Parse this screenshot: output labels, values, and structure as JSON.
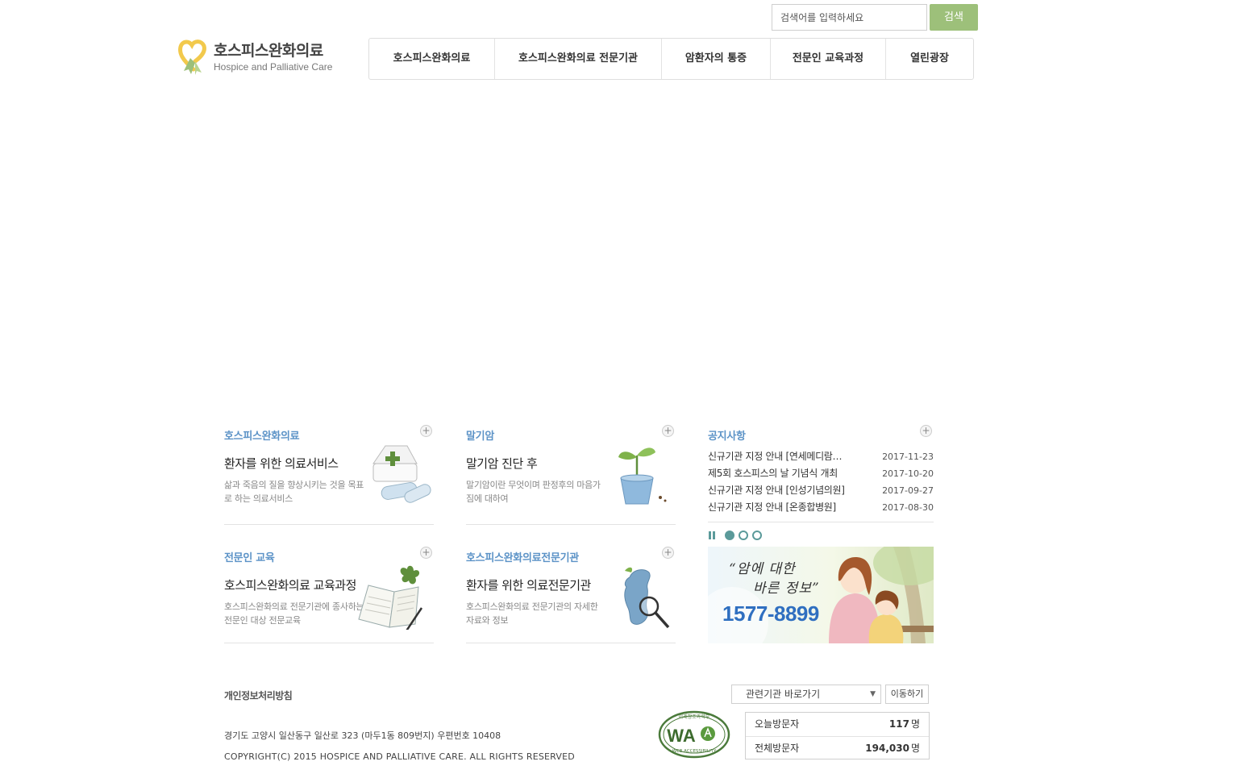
{
  "search": {
    "placeholder": "검색어를 입력하세요",
    "button_label": "검색"
  },
  "logo": {
    "title": "호스피스완화의료",
    "subtitle": "Hospice and Palliative Care"
  },
  "nav": {
    "items": [
      {
        "label": "호스피스완화의료"
      },
      {
        "label": "호스피스완화의료 전문기관"
      },
      {
        "label": "암환자의 통증"
      },
      {
        "label": "전문인 교육과정"
      },
      {
        "label": "열린광장"
      }
    ]
  },
  "boxes": {
    "hospice": {
      "title": "호스피스완화의료",
      "heading": "환자를 위한 의료서비스",
      "desc": "삶과 죽음의 질을 향상시키는 것을 목표로 하는 의료서비스",
      "more": "+"
    },
    "terminal": {
      "title": "말기암",
      "heading": "말기암 진단 후",
      "desc": "말기암이란 무엇이며 판정후의 마음가짐에 대하여",
      "more": "+"
    },
    "education": {
      "title": "전문인 교육",
      "heading": "호스피스완화의료 교육과정",
      "desc": "호스피스완화의료 전문기관에 종사하는 전문인 대상 전문교육",
      "more": "+"
    },
    "institution": {
      "title": "호스피스완화의료전문기관",
      "heading": "환자를 위한 의료전문기관",
      "desc": "호스피스완화의료 전문기관의 자세한 자료와 정보",
      "more": "+"
    }
  },
  "notice": {
    "title": "공지사항",
    "more": "+",
    "items": [
      {
        "text": "신규기관 지정 안내 [연세메디람…",
        "date": "2017-11-23"
      },
      {
        "text": "제5회 호스피스의 날 기념식 개최",
        "date": "2017-10-20"
      },
      {
        "text": "신규기관 지정 안내 [인성기념의원]",
        "date": "2017-09-27"
      },
      {
        "text": "신규기관 지정 안내 [온종합병원]",
        "date": "2017-08-30"
      }
    ]
  },
  "banner": {
    "quote_line1": "“암에 대한",
    "quote_line2": "바른 정보”",
    "phone": "1577-8899"
  },
  "footer": {
    "privacy_link": "개인정보처리방침",
    "address": "경기도 고양시 일산동구 일산로 323 (마두1동 809번지) 우편번호 10408",
    "copyright": "COPYRIGHT(C) 2015 HOSPICE AND PALLIATIVE CARE. ALL RIGHTS RESERVED",
    "select_value": "관련기관 바로가기",
    "go_button": "이동하기",
    "wa_text": "WA",
    "wa_caption": "WEB ACCESSIBILITY",
    "wa_top": "미래창조과학부",
    "visitors": [
      {
        "label": "오늘방문자",
        "value": "117",
        "unit": "명"
      },
      {
        "label": "전체방문자",
        "value": "194,030",
        "unit": "명"
      }
    ]
  },
  "colors": {
    "accent_green": "#9dc07a",
    "title_blue": "#5c93c7",
    "phone_blue": "#2f6fc0",
    "slider_teal": "#5b9a9a"
  }
}
